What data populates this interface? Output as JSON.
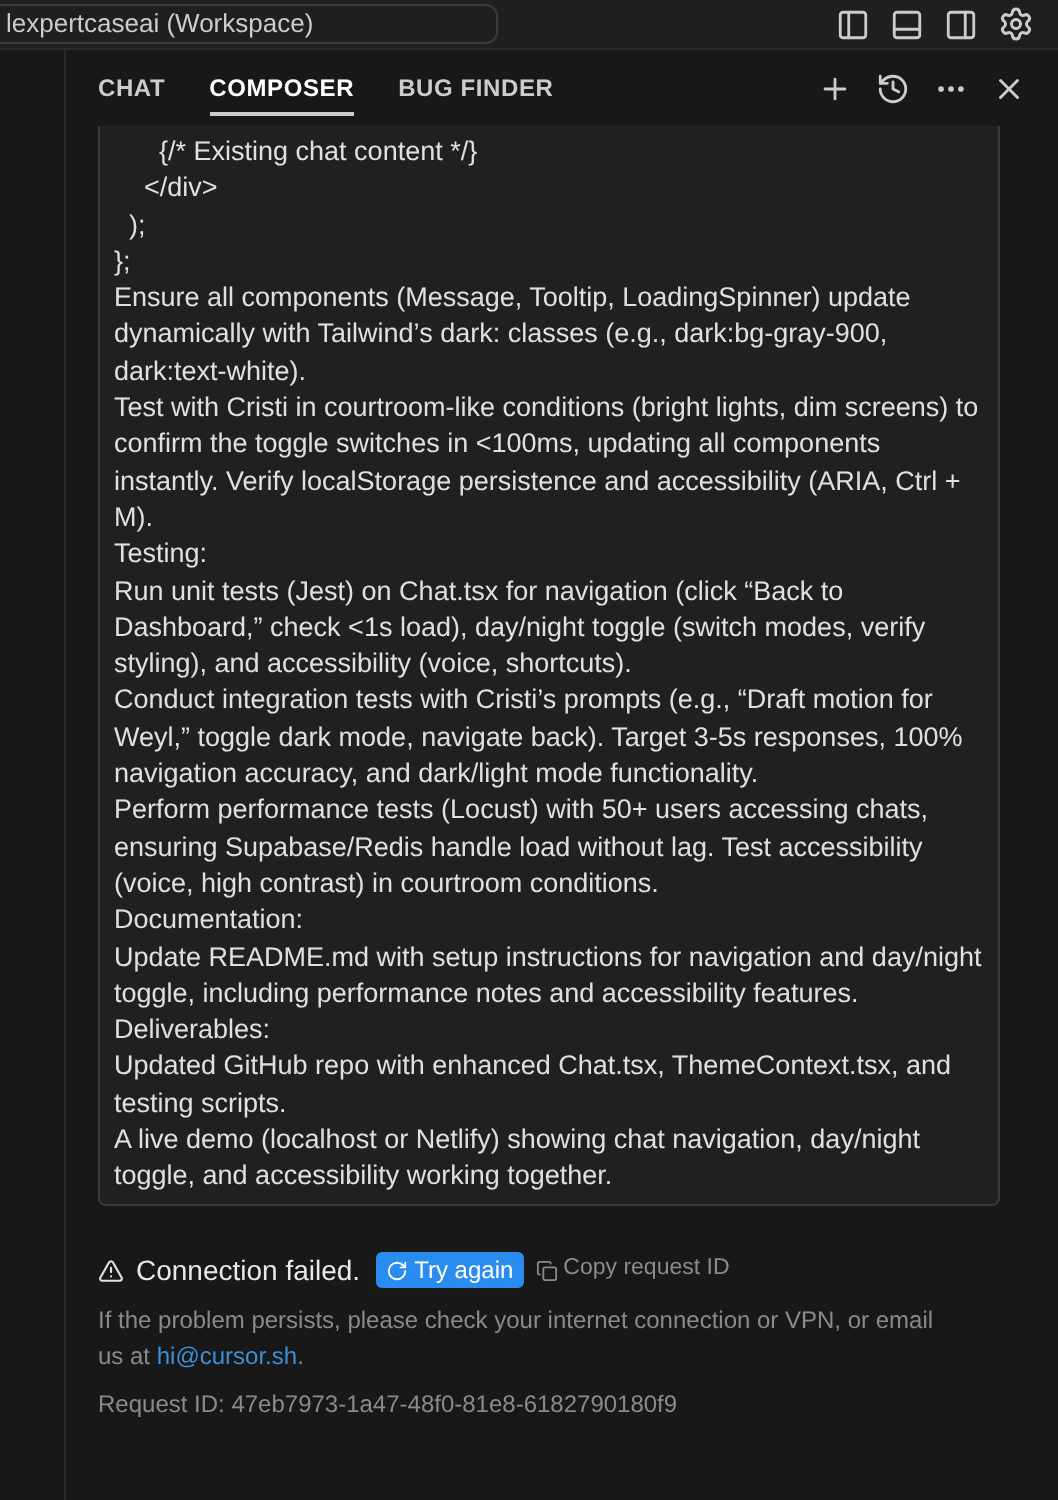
{
  "workspace_title": "lexpertcaseai (Workspace)",
  "tabs": [
    {
      "label": "CHAT",
      "selected": false
    },
    {
      "label": "COMPOSER",
      "selected": true
    },
    {
      "label": "BUG FINDER",
      "selected": false
    }
  ],
  "message": {
    "lines": [
      {
        "kind": "code",
        "text": "      {/* Existing chat content */}"
      },
      {
        "kind": "code",
        "text": "    </div>"
      },
      {
        "kind": "code",
        "text": "  );"
      },
      {
        "kind": "code",
        "text": "};"
      },
      {
        "kind": "text",
        "text": "Ensure all components (Message, Tooltip, LoadingSpinner) update dynamically with Tailwind’s dark: classes (e.g., dark:bg-gray-900, dark:text-white)."
      },
      {
        "kind": "text",
        "text": "Test with Cristi in courtroom-like conditions (bright lights, dim screens) to confirm the toggle switches in <100ms, updating all components instantly. Verify localStorage persistence and accessibility (ARIA, Ctrl + M)."
      },
      {
        "kind": "text",
        "text": "Testing:"
      },
      {
        "kind": "text",
        "text": "Run unit tests (Jest) on Chat.tsx for navigation (click “Back to Dashboard,” check <1s load), day/night toggle (switch modes, verify styling), and accessibility (voice, shortcuts)."
      },
      {
        "kind": "text",
        "text": "Conduct integration tests with Cristi’s prompts (e.g., “Draft motion for Weyl,” toggle dark mode, navigate back). Target 3-5s responses, 100% navigation accuracy, and dark/light mode functionality."
      },
      {
        "kind": "text",
        "text": "Perform performance tests (Locust) with 50+ users accessing chats, ensuring Supabase/Redis handle load without lag. Test accessibility (voice, high contrast) in courtroom conditions."
      },
      {
        "kind": "text",
        "text": "Documentation:"
      },
      {
        "kind": "text",
        "text": "Update README.md with setup instructions for navigation and day/night toggle, including performance notes and accessibility features."
      },
      {
        "kind": "text",
        "text": "Deliverables:"
      },
      {
        "kind": "text",
        "text": "Updated GitHub repo with enhanced Chat.tsx, ThemeContext.tsx, and testing scripts."
      },
      {
        "kind": "text",
        "text": "A live demo (localhost or Netlify) showing chat navigation, day/night toggle, and accessibility working together."
      }
    ]
  },
  "error": {
    "title": "Connection failed.",
    "retry_button": "Try again",
    "copy_button": "Copy request ID",
    "help_before": "If the problem persists, please check your internet connection or VPN, or email us at",
    "help_link": "hi@cursor.sh",
    "help_after": ".",
    "request_id": "Request ID: 47eb7973-1a47-48f0-81e8-6182790180f9"
  }
}
